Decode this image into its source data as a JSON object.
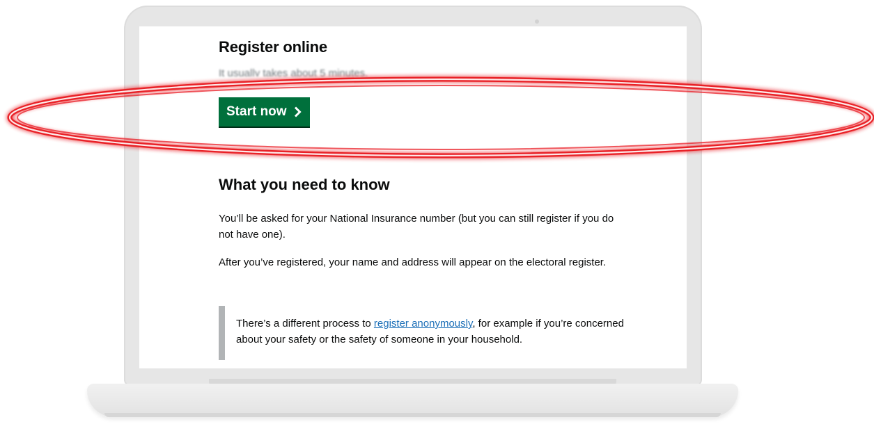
{
  "page": {
    "register_heading": "Register online",
    "duration_text": "It usually takes about 5 minutes.",
    "start_button_label": "Start now",
    "need_heading": "What you need to know",
    "paragraph_1": "You’ll be asked for your National Insurance number (but you can still register if you do not have one).",
    "paragraph_2": "After you’ve registered, your name and address will appear on the electoral register.",
    "inset_before": "There’s a different process to ",
    "inset_link": "register anonymously",
    "inset_after": ", for example if you’re concerned about your safety or the safety of someone in your household."
  },
  "colors": {
    "button_green": "#00703c",
    "link_blue": "#1d70b8",
    "highlight_red": "#e8141c",
    "inset_border": "#b1b4b6"
  },
  "icons": {
    "start_button": "chevron-right-icon"
  }
}
